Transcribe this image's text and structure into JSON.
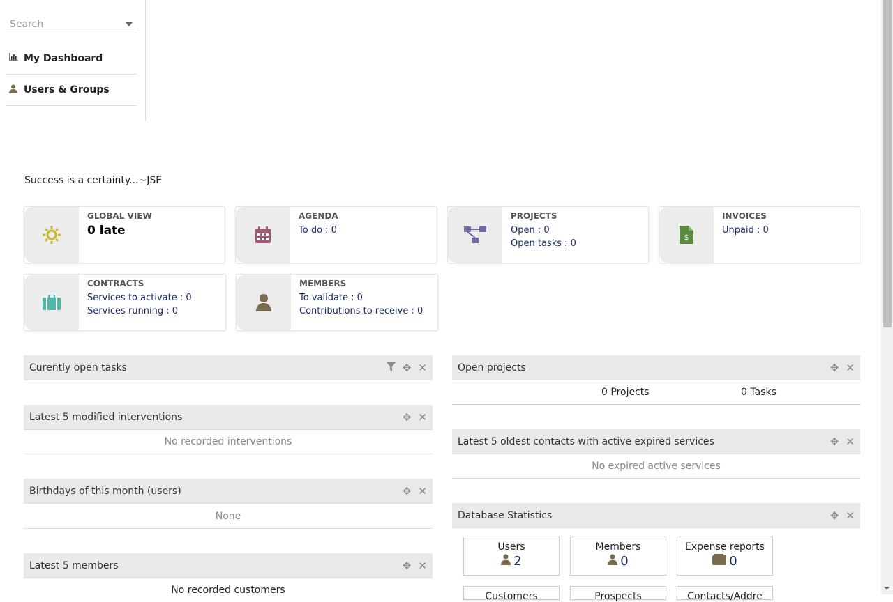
{
  "sidebar": {
    "search_placeholder": "Search",
    "items": [
      {
        "label": "My Dashboard",
        "icon": "bar-chart-icon"
      },
      {
        "label": "Users & Groups",
        "icon": "user-icon"
      }
    ]
  },
  "quote": "Success is a certainty...~JSE",
  "boxes": [
    {
      "title": "GLOBAL VIEW",
      "big": "0 late",
      "icon": "sun-icon",
      "color": "#c8b92a"
    },
    {
      "title": "AGENDA",
      "lines": [
        "To do : 0"
      ],
      "icon": "calendar-icon",
      "color": "#9b5c73"
    },
    {
      "title": "PROJECTS",
      "lines": [
        "Open : 0",
        "Open tasks : 0"
      ],
      "icon": "project-tree-icon",
      "color": "#6c6aa1"
    },
    {
      "title": "INVOICES",
      "lines": [
        "Unpaid : 0"
      ],
      "icon": "invoice-icon",
      "color": "#5a8a3e"
    },
    {
      "title": "CONTRACTS",
      "lines": [
        "Services to activate : 0",
        "Services running : 0"
      ],
      "icon": "suitcase-icon",
      "color": "#4fb8a8"
    },
    {
      "title": "MEMBERS",
      "lines": [
        "To validate : 0",
        "Contributions to receive : 0"
      ],
      "icon": "member-icon",
      "color": "#7a6a4f"
    }
  ],
  "widgets_left": [
    {
      "title": "Curently open tasks",
      "has_filter": true,
      "empty": ""
    },
    {
      "title": "Latest 5 modified interventions",
      "empty": "No recorded interventions"
    },
    {
      "title": "Birthdays of this month (users)",
      "empty": "None"
    },
    {
      "title": "Latest 5 members",
      "empty": "No recorded customers"
    }
  ],
  "widgets_right": [
    {
      "title": "Open projects",
      "projects": "0 Projects",
      "tasks": "0 Tasks"
    },
    {
      "title": "Latest 5 oldest contacts with active expired services",
      "empty": "No expired active services"
    },
    {
      "title": "Database Statistics"
    }
  ],
  "db_stats": [
    {
      "label": "Users",
      "value": "2",
      "icon": "user-icon"
    },
    {
      "label": "Members",
      "value": "0",
      "icon": "user-icon"
    },
    {
      "label": "Expense reports",
      "value": "0",
      "icon": "wallet-icon"
    },
    {
      "label": "Customers",
      "value": ""
    },
    {
      "label": "Prospects",
      "value": ""
    },
    {
      "label": "Contacts/Addre",
      "value": ""
    }
  ]
}
